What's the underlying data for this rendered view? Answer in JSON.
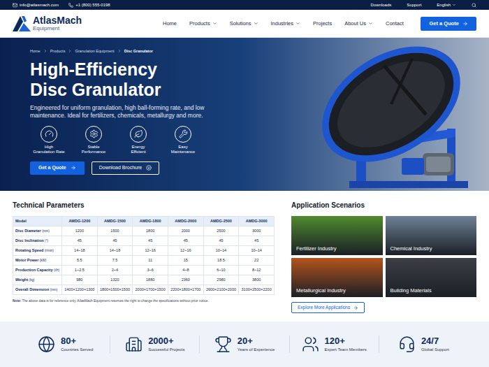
{
  "topbar": {
    "email": "info@atlasmach.com",
    "phone": "+1 (800) 555-0198",
    "links": [
      "Downloads",
      "Support"
    ],
    "language": "English"
  },
  "logo": {
    "name": "AtlasMach",
    "tagline": "Equipment"
  },
  "nav": {
    "items": [
      {
        "label": "Home",
        "dropdown": false
      },
      {
        "label": "Products",
        "dropdown": true
      },
      {
        "label": "Solutions",
        "dropdown": true
      },
      {
        "label": "Industries",
        "dropdown": true
      },
      {
        "label": "Projects",
        "dropdown": false
      },
      {
        "label": "About Us",
        "dropdown": true
      },
      {
        "label": "Contact",
        "dropdown": false
      }
    ],
    "cta": "Get a Quote"
  },
  "hero": {
    "breadcrumb": [
      {
        "label": "Home",
        "current": false
      },
      {
        "label": "Products",
        "current": false
      },
      {
        "label": "Granulation Equipment",
        "current": false
      },
      {
        "label": "Disc Granulator",
        "current": true
      }
    ],
    "title_lines": [
      "High-Efficiency",
      "Disc Granulator"
    ],
    "description": "Engineered for uniform granulation, high ball-forming rate, and low maintenance. Ideal for fertilizers, chemicals, metallurgy and more.",
    "features": [
      {
        "lines": [
          "High",
          "Granulation Rate"
        ]
      },
      {
        "lines": [
          "Stable",
          "Performance"
        ]
      },
      {
        "lines": [
          "Energy",
          "Efficient"
        ]
      },
      {
        "lines": [
          "Easy",
          "Maintenance"
        ]
      }
    ],
    "primary_button": "Get a Quote",
    "secondary_button": "Download Brochure"
  },
  "parameters": {
    "title": "Technical Parameters",
    "columns": [
      "Model",
      "AMDG-1200",
      "AMDG-1500",
      "AMDG-1800",
      "AMDG-2000",
      "AMDG-2500",
      "AMDG-3000"
    ],
    "rows": [
      {
        "label": "Disc Diameter",
        "unit": "(mm)",
        "values": [
          "1200",
          "1500",
          "1800",
          "2000",
          "2500",
          "3000"
        ]
      },
      {
        "label": "Disc Inclination",
        "unit": "(°)",
        "values": [
          "45",
          "45",
          "45",
          "45",
          "45",
          "45"
        ]
      },
      {
        "label": "Rotating Speed",
        "unit": "(r/min)",
        "values": [
          "14~18",
          "14~18",
          "12~16",
          "12~16",
          "10~14",
          "10~14"
        ]
      },
      {
        "label": "Motor Power",
        "unit": "(kW)",
        "values": [
          "5.5",
          "7.5",
          "11",
          "15",
          "18.5",
          "22"
        ]
      },
      {
        "label": "Production Capacity",
        "unit": "(t/h)",
        "values": [
          "1~2.5",
          "2~4",
          "3~6",
          "4~8",
          "6~10",
          "8~12"
        ]
      },
      {
        "label": "Weight",
        "unit": "(kg)",
        "values": [
          "980",
          "1320",
          "1880",
          "2360",
          "2980",
          "3800"
        ]
      },
      {
        "label": "Overall Dimension",
        "unit": "(mm)",
        "values": [
          "1400×1200×1300",
          "1800×1500×1500",
          "2000×1700×1500",
          "2200×1800×1700",
          "2600×2100×2000",
          "3100×2500×2200"
        ]
      }
    ],
    "note_label": "Note:",
    "note": "The above data is for reference only. AtlasMach Equipment reserves the right to change the specifications without prior notice."
  },
  "applications": {
    "title": "Application Scenarios",
    "items": [
      {
        "label": "Fertilizer Industry",
        "color": "#4f8a2e"
      },
      {
        "label": "Chemical Industry",
        "color": "#6f8196"
      },
      {
        "label": "Metallurgical Industry",
        "color": "#b4531c"
      },
      {
        "label": "Building Materials",
        "color": "#3b3f45"
      }
    ],
    "button": "Explore More Applications"
  },
  "stats": [
    {
      "value": "80+",
      "label": "Countries Served"
    },
    {
      "value": "2000+",
      "label": "Successful Projects"
    },
    {
      "value": "20+",
      "label": "Years of Experience"
    },
    {
      "value": "120+",
      "label": "Expert Team Members"
    },
    {
      "value": "24/7",
      "label": "Global Support"
    }
  ]
}
